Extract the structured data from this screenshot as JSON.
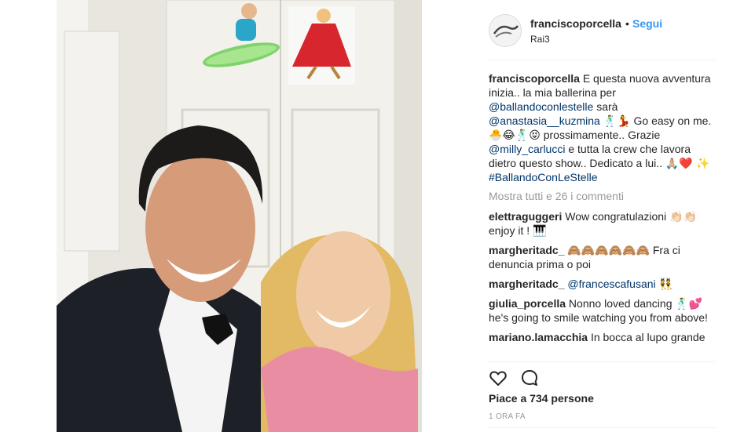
{
  "post": {
    "username": "franciscoporcella",
    "dot": "•",
    "follow_label": "Segui",
    "location": "Rai3",
    "caption": {
      "username": "franciscoporcella",
      "t1": " E questa nuova avventura inizia.. la mia ballerina per ",
      "m1": "@ballandoconlestelle",
      "t2": " sarà ",
      "m2": "@anastasia__kuzmina",
      "t3": " 🕺💃 Go easy on me. 🐣😂🕺😝 prossimamente.. Grazie ",
      "m3": "@milly_carlucci",
      "t4": " e tutta la crew che lavora dietro questo show.. Dedicato a lui.. 🙏🏼❤️ ✨ ",
      "m4": "#BallandoConLeStelle"
    },
    "show_all_comments": "Mostra tutti e 26 i commenti",
    "comments": [
      {
        "user": "elettraguggeri",
        "text": " Wow congratulazioni 👏🏻👏🏻 enjoy it ! 🎹"
      },
      {
        "user": "margheritadc_",
        "text": " 🙈🙈🙈🙈🙈🙈 Fra ci denuncia prima o poi"
      },
      {
        "user": "margheritadc_",
        "mention": "@francescafusani",
        "text": " 👯"
      },
      {
        "user": "giulia_porcella",
        "text": " Nonno loved dancing 🕺💕 he's going to smile watching you from above!"
      },
      {
        "user": "mariano.lamacchia",
        "text": " In bocca al lupo grande"
      }
    ],
    "likes": "Piace a 734 persone",
    "time": "1 ORA FA"
  },
  "icons": {
    "like": "heart-icon",
    "comment": "comment-bubble-icon"
  }
}
